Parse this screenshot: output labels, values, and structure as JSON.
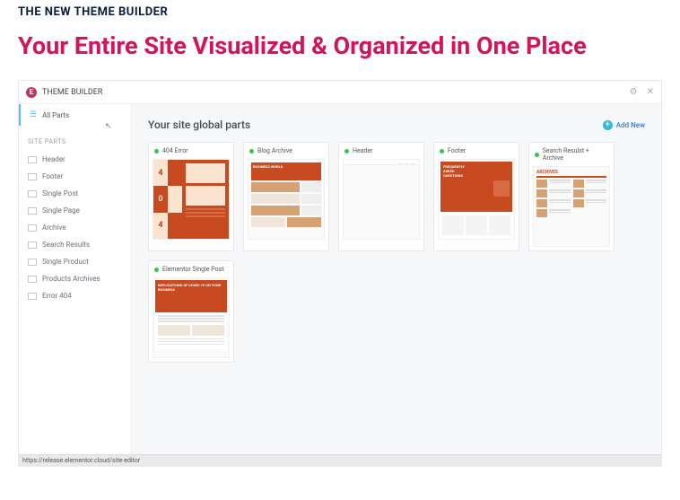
{
  "eyebrow": "THE NEW THEME BUILDER",
  "headline": "Your Entire Site Visualized & Organized in One Place",
  "titlebar": {
    "appName": "THEME BUILDER"
  },
  "sidebar": {
    "allParts": "All Parts",
    "sectionLabel": "SITE PARTS",
    "items": [
      {
        "label": "Header"
      },
      {
        "label": "Footer"
      },
      {
        "label": "Single Post"
      },
      {
        "label": "Single Page"
      },
      {
        "label": "Archive"
      },
      {
        "label": "Search Results"
      },
      {
        "label": "Single Product"
      },
      {
        "label": "Products Archives"
      },
      {
        "label": "Error 404"
      }
    ]
  },
  "main": {
    "title": "Your site global parts",
    "addNew": "Add New",
    "cards": [
      {
        "title": "404 Error"
      },
      {
        "title": "Blog Archive"
      },
      {
        "title": "Header"
      },
      {
        "title": "Footer"
      },
      {
        "title": "Search Resulst + Archive"
      },
      {
        "title": "Elementor Single Post"
      }
    ],
    "archiveLabel": "ARCHIVES",
    "postHero": "IMPLICATIONS OF COVID-19 ON YOUR BUSINESS"
  },
  "statusbar": "https://release.elementor.cloud/site-editor"
}
